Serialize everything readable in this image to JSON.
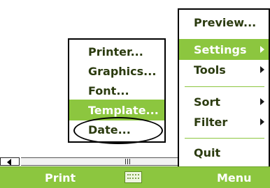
{
  "main_menu": {
    "items": [
      {
        "label": "Preview...",
        "submenu": false,
        "selected": false
      },
      {
        "label": "Settings",
        "submenu": true,
        "selected": true
      },
      {
        "label": "Tools",
        "submenu": true,
        "selected": false
      },
      {
        "label": "Sort",
        "submenu": true,
        "selected": false
      },
      {
        "label": "Filter",
        "submenu": true,
        "selected": false
      },
      {
        "label": "Quit",
        "submenu": false,
        "selected": false
      }
    ]
  },
  "settings_submenu": {
    "items": [
      {
        "label": "Printer...",
        "selected": false
      },
      {
        "label": "Graphics...",
        "selected": false
      },
      {
        "label": "Font...",
        "selected": false
      },
      {
        "label": "Template...",
        "selected": true,
        "circled": true
      },
      {
        "label": "Date...",
        "selected": false
      }
    ]
  },
  "softkeys": {
    "left": "Print",
    "right": "Menu",
    "center_icon": "keyboard-icon"
  },
  "colors": {
    "accent": "#8cc63f",
    "text": "#2b3b0f",
    "border": "#000000"
  }
}
